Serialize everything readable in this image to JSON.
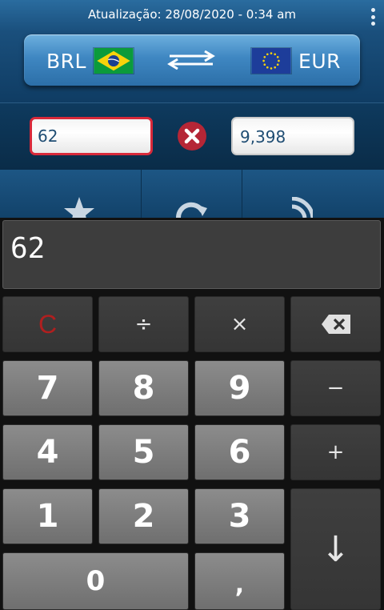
{
  "header": {
    "updated_text": "Atualização: 28/08/2020 - 0:34 am"
  },
  "currency_bar": {
    "from_code": "BRL",
    "to_code": "EUR",
    "from_flag": "brazil-flag",
    "to_flag": "eu-flag"
  },
  "conversion": {
    "input_value": "62",
    "result_value": "9,398"
  },
  "keypad": {
    "display_value": "62",
    "row1": {
      "clear": "C",
      "divide": "÷",
      "multiply": "×",
      "backspace_icon": "backspace-icon"
    },
    "row2": {
      "k7": "7",
      "k8": "8",
      "k9": "9",
      "minus": "−"
    },
    "row3": {
      "k4": "4",
      "k5": "5",
      "k6": "6",
      "plus": "+"
    },
    "row4": {
      "k1": "1",
      "k2": "2",
      "k3": "3",
      "enter": "↓"
    },
    "row5": {
      "k0": "0",
      "comma": ","
    }
  },
  "colors": {
    "accent_blue": "#3f87c2",
    "active_border": "#d8293a",
    "clear_red": "#b01f1f"
  }
}
